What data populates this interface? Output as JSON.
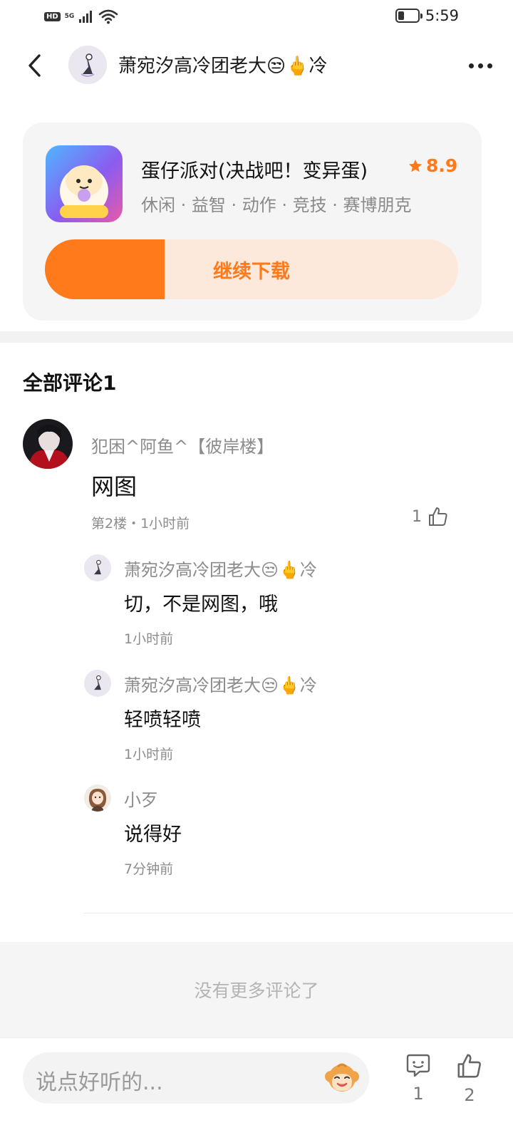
{
  "status_bar": {
    "hd": "HD",
    "network": "5G",
    "time": "5:59",
    "battery_level": 0.3
  },
  "header": {
    "title": "萧宛汐高冷团老大😒🖕冷",
    "back_icon": "chevron-left-icon",
    "more_icon": "more-dots-icon"
  },
  "game": {
    "name": "蛋仔派对(决战吧！变异蛋)",
    "rating": "8.9",
    "tags": "休闲 · 益智 · 动作 · 竞技 · 赛博朋克",
    "download_label": "继续下载",
    "download_progress": 0.29,
    "accent_color": "#ff7a1a"
  },
  "comments_section": {
    "title": "全部评论1"
  },
  "main_comment": {
    "user": "犯困^阿鱼^【彼岸楼】",
    "text": "网图",
    "meta": "第2楼・1小时前",
    "likes": "1"
  },
  "replies": [
    {
      "user": "萧宛汐高冷团老大😒🖕冷",
      "text": "切，不是网图，哦",
      "time": "1小时前"
    },
    {
      "user": "萧宛汐高冷团老大😒🖕冷",
      "text": "轻喷轻喷",
      "time": "1小时前"
    },
    {
      "user": "小歹",
      "text": "说得好",
      "time": "7分钟前"
    }
  ],
  "footer": {
    "no_more": "没有更多评论了"
  },
  "bottom_bar": {
    "placeholder": "说点好听的...",
    "comment_count": "1",
    "like_count": "2"
  }
}
